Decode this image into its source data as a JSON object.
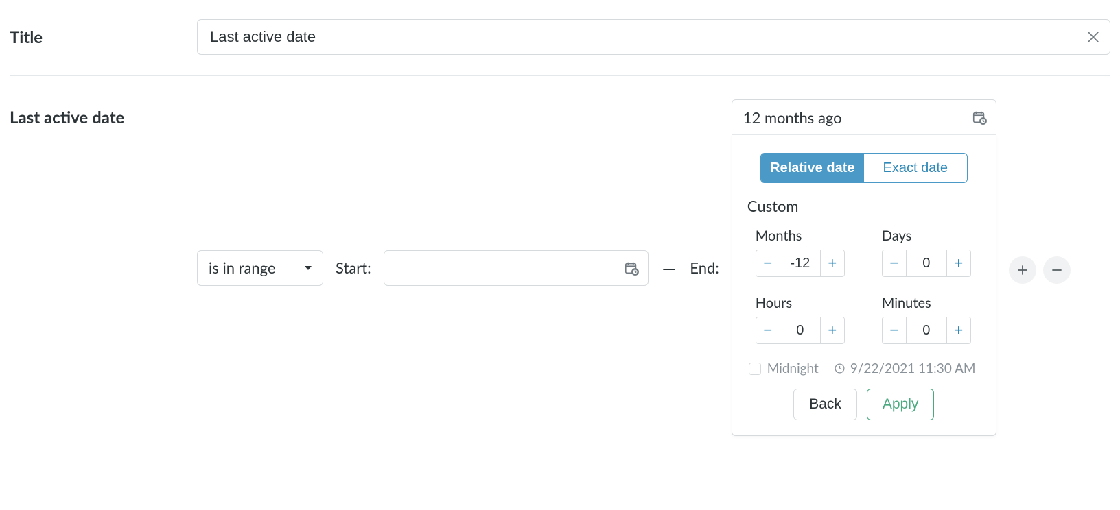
{
  "title_row": {
    "label": "Title",
    "value": "Last active date"
  },
  "filter": {
    "field_label": "Last active date",
    "operator": "is in range",
    "start_label": "Start:",
    "start_value": "",
    "dash": "—",
    "end_label": "End:",
    "end_value": "12 months ago"
  },
  "popover": {
    "tab_relative": "Relative date",
    "tab_exact": "Exact date",
    "custom_label": "Custom",
    "units": {
      "months": {
        "label": "Months",
        "value": "-12"
      },
      "days": {
        "label": "Days",
        "value": "0"
      },
      "hours": {
        "label": "Hours",
        "value": "0"
      },
      "minutes": {
        "label": "Minutes",
        "value": "0"
      }
    },
    "midnight_label": "Midnight",
    "preview": "9/22/2021 11:30 AM",
    "back": "Back",
    "apply": "Apply"
  },
  "glyphs": {
    "minus": "−",
    "plus": "+"
  }
}
